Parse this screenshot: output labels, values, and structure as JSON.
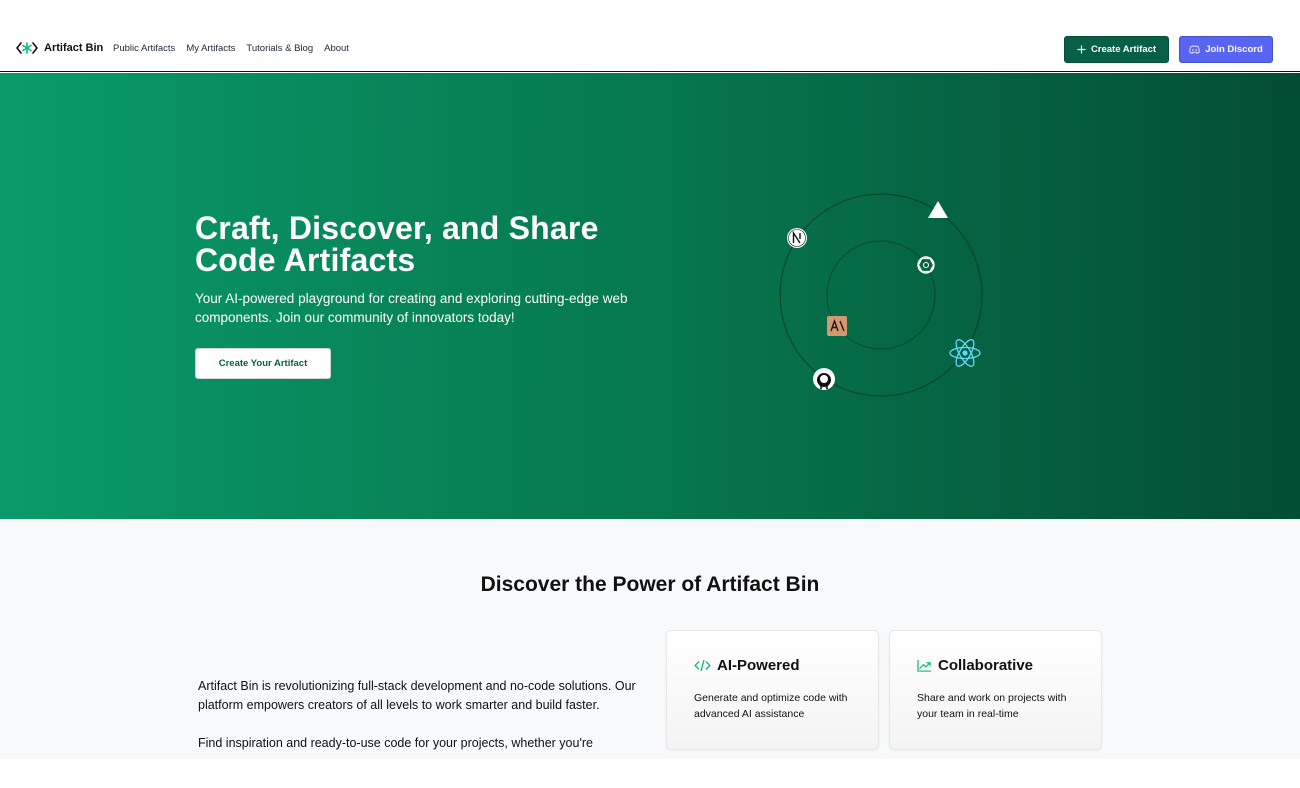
{
  "header": {
    "brand": "Artifact Bin",
    "nav": [
      "Public Artifacts",
      "My Artifacts",
      "Tutorials & Blog",
      "About"
    ],
    "create_label": "Create Artifact",
    "discord_label": "Join Discord"
  },
  "hero": {
    "title": "Craft, Discover, and Share Code Artifacts",
    "subtitle": "Your AI-powered playground for creating and exploring cutting-edge web components. Join our community of innovators today!",
    "cta": "Create Your Artifact",
    "orbit_icons": [
      "nextjs-icon",
      "vercel-icon",
      "openai-icon",
      "anthropic-icon",
      "react-icon",
      "github-icon"
    ]
  },
  "features": {
    "title": "Discover the Power of Artifact Bin",
    "intro_p1": "Artifact Bin is revolutionizing full-stack development and no-code solutions. Our platform empowers creators of all levels to work smarter and build faster.",
    "intro_p2": "Find inspiration and ready-to-use code for your projects, whether you're",
    "cards": [
      {
        "title": "AI-Powered",
        "desc": "Generate and optimize code with advanced AI assistance",
        "icon": "code-icon"
      },
      {
        "title": "Collaborative",
        "desc": "Share and work on projects with your team in real-time",
        "icon": "trending-up-icon"
      }
    ]
  },
  "colors": {
    "brand_green": "#065f46",
    "accent_green": "#10b981",
    "discord": "#5865f2",
    "hero_start": "#0a9a6a",
    "hero_end": "#044d35"
  }
}
